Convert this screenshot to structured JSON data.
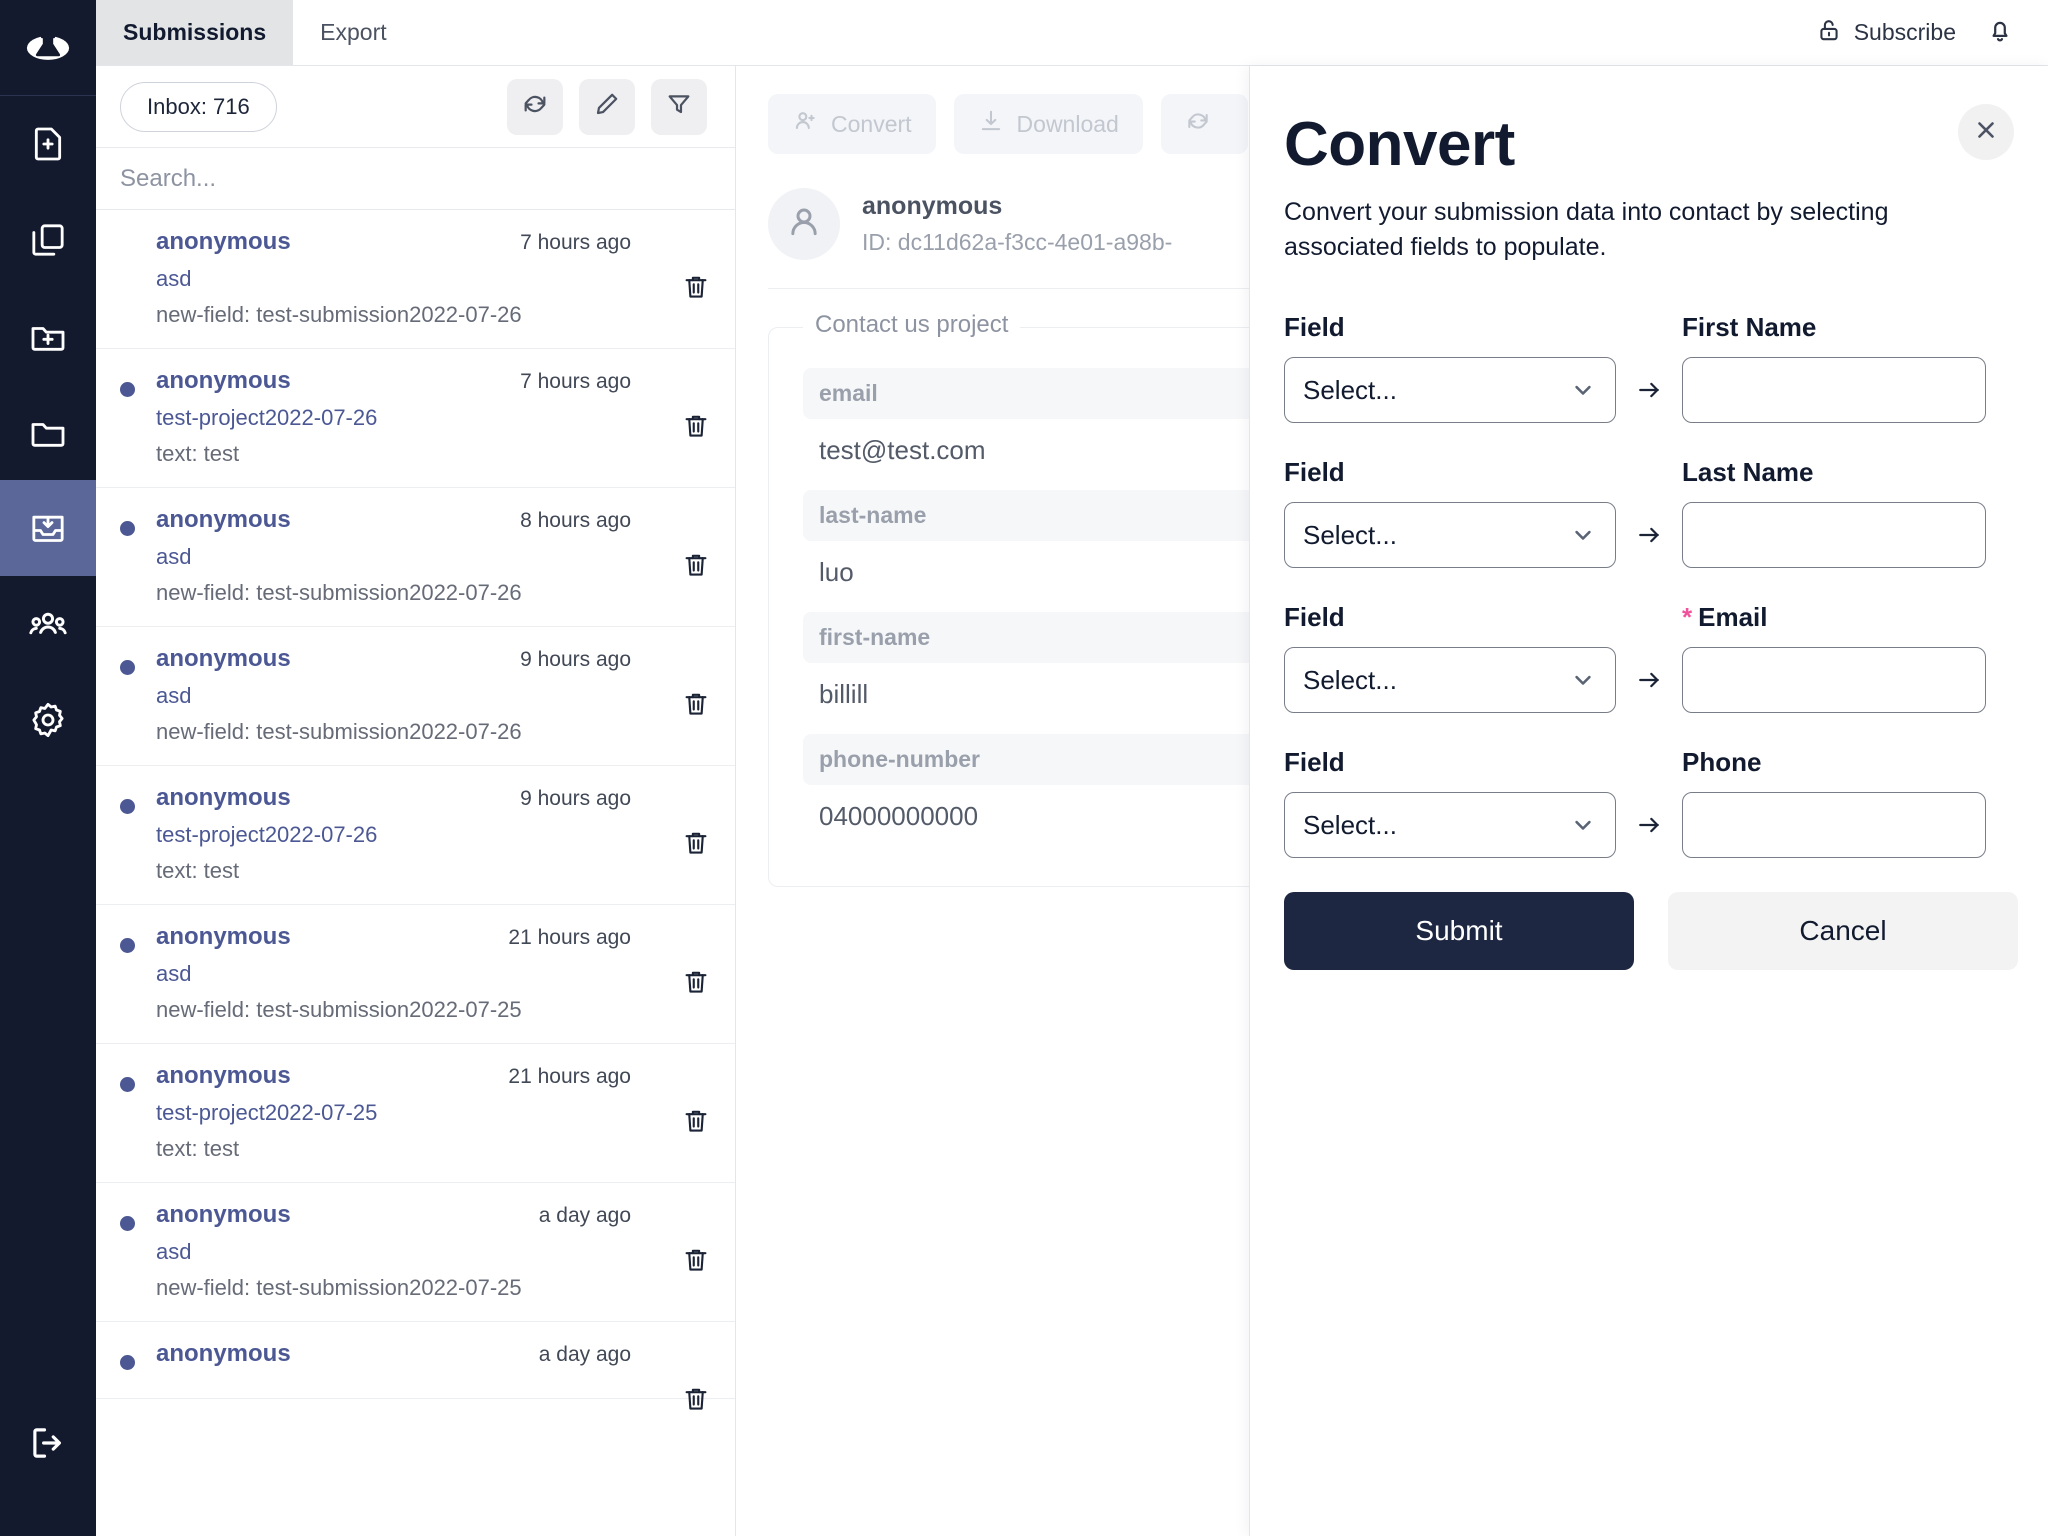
{
  "sidebar": {
    "logo_icon": "flask-logo-icon",
    "items": [
      {
        "icon": "file-plus-icon",
        "name": "new-file",
        "active": false
      },
      {
        "icon": "copy-files-icon",
        "name": "files",
        "active": false
      },
      {
        "icon": "folder-plus-icon",
        "name": "new-folder",
        "active": false
      },
      {
        "icon": "folder-icon",
        "name": "folders",
        "active": false
      },
      {
        "icon": "inbox-download-icon",
        "name": "submissions",
        "active": true
      },
      {
        "icon": "users-icon",
        "name": "contacts",
        "active": false
      },
      {
        "icon": "gear-icon",
        "name": "settings",
        "active": false
      }
    ],
    "logout_icon": "logout-icon"
  },
  "header": {
    "tabs": [
      {
        "label": "Submissions",
        "active": true
      },
      {
        "label": "Export",
        "active": false
      }
    ],
    "subscribe_label": "Subscribe",
    "subscribe_icon": "unlock-icon",
    "bell_icon": "bell-icon"
  },
  "list_panel": {
    "inbox_label": "Inbox: 716",
    "toolbar_icons": [
      "refresh-icon",
      "pencil-icon",
      "filter-icon"
    ],
    "search_placeholder": "Search...",
    "search_value": "",
    "items": [
      {
        "unread": false,
        "name": "anonymous",
        "time": "7 hours ago",
        "project": "asd",
        "preview": "new-field: test-submission2022-07-26"
      },
      {
        "unread": true,
        "name": "anonymous",
        "time": "7 hours ago",
        "project": "test-project2022-07-26",
        "preview": "text: test"
      },
      {
        "unread": true,
        "name": "anonymous",
        "time": "8 hours ago",
        "project": "asd",
        "preview": "new-field: test-submission2022-07-26"
      },
      {
        "unread": true,
        "name": "anonymous",
        "time": "9 hours ago",
        "project": "asd",
        "preview": "new-field: test-submission2022-07-26"
      },
      {
        "unread": true,
        "name": "anonymous",
        "time": "9 hours ago",
        "project": "test-project2022-07-26",
        "preview": "text: test"
      },
      {
        "unread": true,
        "name": "anonymous",
        "time": "21 hours ago",
        "project": "asd",
        "preview": "new-field: test-submission2022-07-25"
      },
      {
        "unread": true,
        "name": "anonymous",
        "time": "21 hours ago",
        "project": "test-project2022-07-25",
        "preview": "text: test"
      },
      {
        "unread": true,
        "name": "anonymous",
        "time": "a day ago",
        "project": "asd",
        "preview": "new-field: test-submission2022-07-25"
      },
      {
        "unread": true,
        "name": "anonymous",
        "time": "a day ago",
        "project": "",
        "preview": ""
      }
    ]
  },
  "detail_panel": {
    "buttons": [
      {
        "label": "Convert",
        "icon": "user-plus-icon"
      },
      {
        "label": "Download",
        "icon": "download-icon"
      },
      {
        "label": "",
        "icon": "refresh-icon"
      }
    ],
    "avatar_icon": "user-avatar-icon",
    "contact_name": "anonymous",
    "contact_id": "ID: dc11d62a-f3cc-4e01-a98b-",
    "project_legend": "Contact us project",
    "fields": [
      {
        "key": "email",
        "value": "test@test.com"
      },
      {
        "key": "last-name",
        "value": "luo"
      },
      {
        "key": "first-name",
        "value": "billill"
      },
      {
        "key": "phone-number",
        "value": "04000000000"
      }
    ]
  },
  "modal": {
    "title": "Convert",
    "description": "Convert your submission data into contact by selecting associated fields to populate.",
    "close_icon": "close-icon",
    "field_label": "Field",
    "select_placeholder": "Select...",
    "chevron_icon": "chevron-down-icon",
    "arrow_icon": "arrow-right-icon",
    "rows": [
      {
        "field_label": "Field",
        "select_value": "Select...",
        "target_label": "First Name",
        "required": false,
        "target_value": ""
      },
      {
        "field_label": "Field",
        "select_value": "Select...",
        "target_label": "Last Name",
        "required": false,
        "target_value": ""
      },
      {
        "field_label": "Field",
        "select_value": "Select...",
        "target_label": "Email",
        "required": true,
        "target_value": ""
      },
      {
        "field_label": "Field",
        "select_value": "Select...",
        "target_label": "Phone",
        "required": false,
        "target_value": ""
      }
    ],
    "required_marker": "*",
    "submit_label": "Submit",
    "cancel_label": "Cancel"
  },
  "colors": {
    "sidebar_bg": "#131a2e",
    "sidebar_active": "#5a6798",
    "accent_blue": "#4c5894",
    "dark_navy": "#111a2f",
    "submit_bg": "#1e2741",
    "required_pink": "#f0539b"
  }
}
